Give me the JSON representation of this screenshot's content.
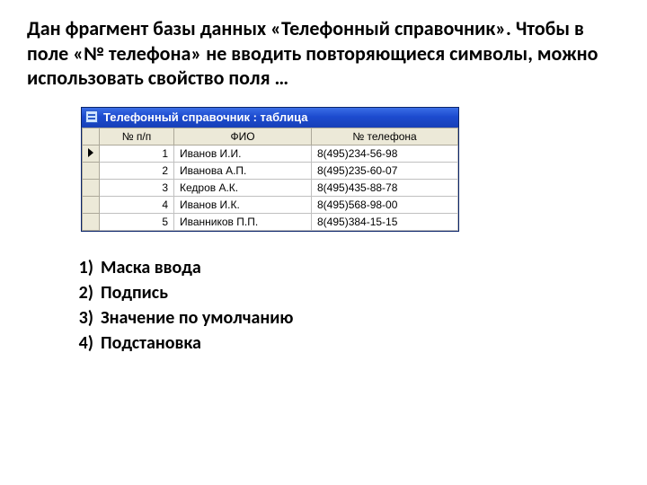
{
  "question": "Дан фрагмент базы данных «Телефонный справочник». Чтобы в поле «№ телефона» не вводить повторяющиеся символы, можно использовать свойство поля …",
  "window_title": "Телефонный справочник : таблица",
  "columns": {
    "num": "№ п/п",
    "fio": "ФИО",
    "tel": "№ телефона"
  },
  "rows": [
    {
      "n": "1",
      "fio": "Иванов И.И.",
      "tel": "8(495)234-56-98"
    },
    {
      "n": "2",
      "fio": "Иванова А.П.",
      "tel": "8(495)235-60-07"
    },
    {
      "n": "3",
      "fio": "Кедров А.К.",
      "tel": "8(495)435-88-78"
    },
    {
      "n": "4",
      "fio": "Иванов И.К.",
      "tel": "8(495)568-98-00"
    },
    {
      "n": "5",
      "fio": "Иванников П.П.",
      "tel": "8(495)384-15-15"
    }
  ],
  "answers": [
    {
      "marker": "1)",
      "text": "Маска ввода"
    },
    {
      "marker": "2)",
      "text": "Подпись"
    },
    {
      "marker": "3)",
      "text": "Значение по умолчанию"
    },
    {
      "marker": "4)",
      "text": "Подстановка"
    }
  ]
}
